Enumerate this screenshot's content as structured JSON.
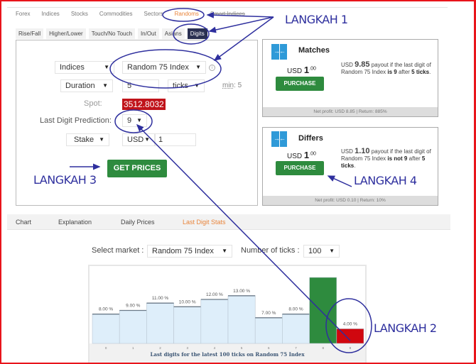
{
  "market_tabs": [
    {
      "label": "Forex",
      "active": false
    },
    {
      "label": "Indices",
      "active": false
    },
    {
      "label": "Stocks",
      "active": false
    },
    {
      "label": "Commodities",
      "active": false
    },
    {
      "label": "Sectors",
      "active": false
    },
    {
      "label": "Randoms",
      "active": true
    },
    {
      "label": "Smart Indices",
      "active": false
    }
  ],
  "contract_tabs": [
    {
      "label": "Rise/Fall",
      "active": false
    },
    {
      "label": "Higher/Lower",
      "active": false
    },
    {
      "label": "Touch/No Touch",
      "active": false
    },
    {
      "label": "In/Out",
      "active": false
    },
    {
      "label": "Asians",
      "active": false
    },
    {
      "label": "Digits",
      "active": true
    }
  ],
  "form": {
    "market_type": "Indices",
    "underlying": "Random 75 Index",
    "duration_type": "Duration",
    "duration_value": "5",
    "duration_unit": "ticks",
    "min_label": "min",
    "min_value": ": 5",
    "spot_label": "Spot:",
    "spot_value": "3512.8032",
    "prediction_label": "Last Digit Prediction:",
    "prediction_value": "9",
    "amount_type": "Stake",
    "currency": "USD",
    "amount_value": "1",
    "get_prices_label": "GET PRICES",
    "caret": "▼",
    "info_icon": "i"
  },
  "cards": [
    {
      "title": "Matches",
      "currency": "USD",
      "price_int": "1",
      "price_dec": ".00",
      "purchase_label": "PURCHASE",
      "desc_currency": "USD",
      "payout": "9.85",
      "desc_a": " payout if the last digit of Random 75 Index ",
      "desc_cond": "is 9",
      "desc_b": " after ",
      "desc_ticks": "5 ticks",
      "desc_end": ".",
      "footer": "Net profit: USD 8.85 | Return: 885%",
      "icon": "→←"
    },
    {
      "title": "Differs",
      "currency": "USD",
      "price_int": "1",
      "price_dec": ".00",
      "purchase_label": "PURCHASE",
      "desc_currency": "USD",
      "payout": "1.10",
      "desc_a": " payout if the last digit of Random 75 Index ",
      "desc_cond": "is not 9",
      "desc_b": " after ",
      "desc_ticks": "5 ticks",
      "desc_end": ".",
      "footer": "Net profit: USD 0.10 | Return: 10%",
      "icon": "→←"
    }
  ],
  "lower_tabs": [
    {
      "label": "Chart",
      "active": false
    },
    {
      "label": "Explanation",
      "active": false
    },
    {
      "label": "Daily Prices",
      "active": false
    },
    {
      "label": "Last Digit Stats",
      "active": true
    }
  ],
  "stats_controls": {
    "market_label": "Select market :",
    "market_value": "Random 75 Index",
    "ticks_label": "Number of ticks :",
    "ticks_value": "100"
  },
  "annotations": {
    "step1": "LANGKAH 1",
    "step2": "LANGKAH 2",
    "step3": "LANGKAH 3",
    "step4": "LANGKAH 4"
  },
  "colors": {
    "accent_orange": "#e9843a",
    "button_green": "#2e8b3e",
    "spot_red": "#c0131a",
    "bar_default": "#deeefa",
    "bar_max": "#2e8b3e",
    "bar_min": "#d0070f",
    "annotation_blue": "#2e2f9e"
  },
  "chart_data": {
    "type": "bar",
    "title": "Last digits for the latest 100 ticks on Random 75 Index",
    "categories": [
      "0",
      "1",
      "2",
      "3",
      "4",
      "5",
      "6",
      "7",
      "8",
      "9"
    ],
    "values": [
      8,
      9,
      11,
      10,
      12,
      13,
      7,
      8,
      18,
      4
    ],
    "labels": [
      "8.00 %",
      "9.00 %",
      "11.00 %",
      "10.00 %",
      "12.00 %",
      "13.00 %",
      "7.00 %",
      "8.00 %",
      "",
      "4.00 %"
    ],
    "highlight": {
      "max_index": 8,
      "min_index": 9
    },
    "unit": "%",
    "xlabel": "",
    "ylabel": "",
    "ylim": [
      0,
      18
    ],
    "grid": false
  }
}
